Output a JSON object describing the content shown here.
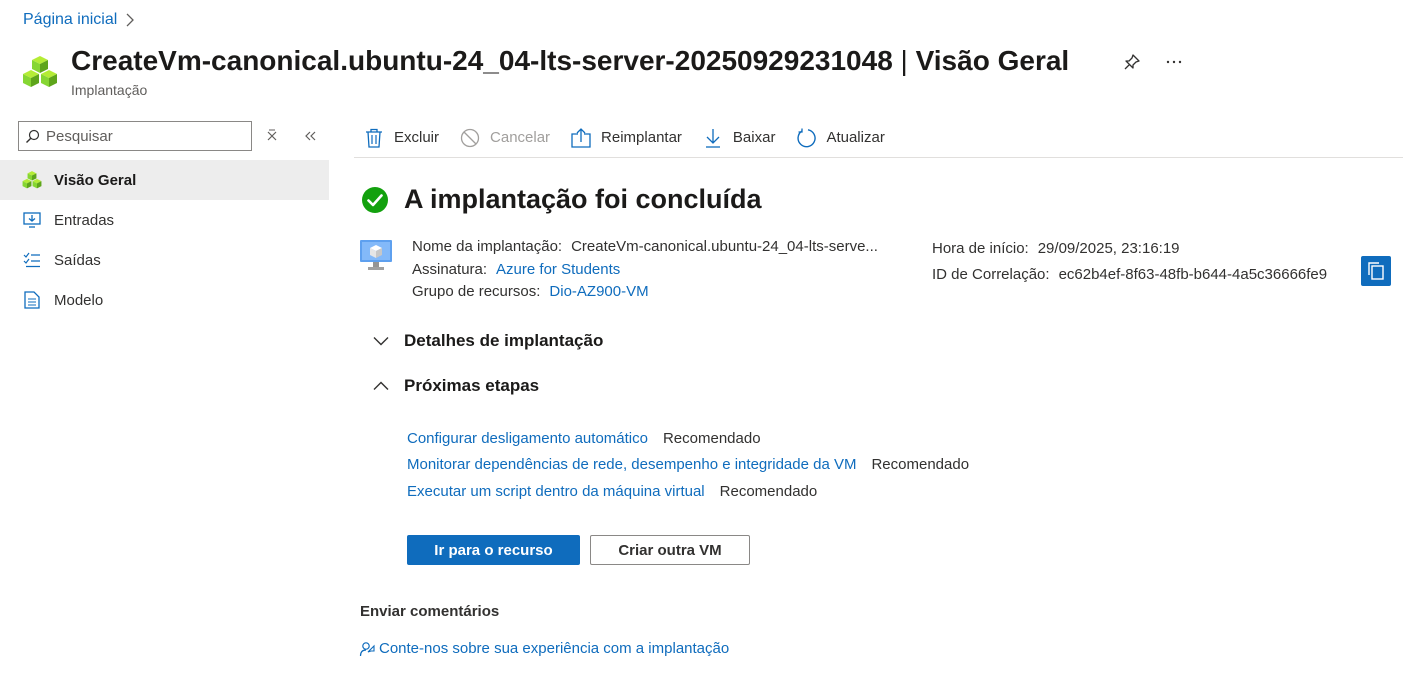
{
  "breadcrumb": {
    "home": "Página inicial"
  },
  "header": {
    "title_main": "CreateVm-canonical.ubuntu-24_04-lts-server-20250929231048",
    "title_sep": " | ",
    "title_section": "Visão Geral",
    "subtitle": "Implantação"
  },
  "search": {
    "placeholder": "Pesquisar"
  },
  "nav": {
    "items": [
      {
        "label": "Visão Geral",
        "icon": "deployment-cubes-icon",
        "active": true
      },
      {
        "label": "Entradas",
        "icon": "inputs-icon"
      },
      {
        "label": "Saídas",
        "icon": "outputs-icon"
      },
      {
        "label": "Modelo",
        "icon": "template-icon"
      }
    ]
  },
  "toolbar": {
    "delete": "Excluir",
    "cancel": "Cancelar",
    "redeploy": "Reimplantar",
    "download": "Baixar",
    "refresh": "Atualizar"
  },
  "status": {
    "title": "A implantação foi concluída"
  },
  "details": {
    "deployment_name_label": "Nome da implantação:",
    "deployment_name_value": "CreateVm-canonical.ubuntu-24_04-lts-serve...",
    "subscription_label": "Assinatura:",
    "subscription_value": "Azure for Students",
    "resource_group_label": "Grupo de recursos:",
    "resource_group_value": "Dio-AZ900-VM",
    "start_time_label": "Hora de início:",
    "start_time_value": "29/09/2025, 23:16:19",
    "correlation_label": "ID de Correlação:",
    "correlation_value": "ec62b4ef-8f63-48fb-b644-4a5c36666fe9"
  },
  "sections": {
    "deployment_details": "Detalhes de implantação",
    "next_steps": "Próximas etapas"
  },
  "next_steps": [
    {
      "label": "Configurar desligamento automático",
      "tag": "Recomendado"
    },
    {
      "label": "Monitorar dependências de rede, desempenho e integridade da VM",
      "tag": "Recomendado"
    },
    {
      "label": "Executar um script dentro da máquina virtual",
      "tag": "Recomendado"
    }
  ],
  "actions": {
    "go_to_resource": "Ir para o recurso",
    "create_another": "Criar outra VM"
  },
  "feedback": {
    "title": "Enviar comentários",
    "link": "Conte-nos sobre sua experiência com a implantação"
  },
  "colors": {
    "accent": "#0f6cbd",
    "success": "#13a10e",
    "nav_active_bg": "#ededed"
  }
}
